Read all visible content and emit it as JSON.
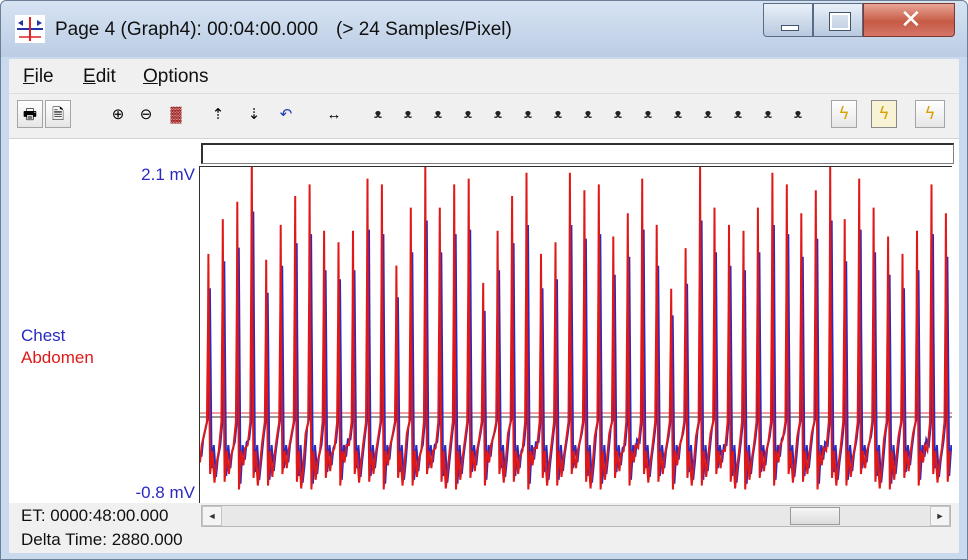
{
  "window": {
    "title": "Page 4 (Graph4): 00:04:00.000",
    "rate": "(> 24 Samples/Pixel)"
  },
  "menu": {
    "file": {
      "first": "F",
      "rest": "ile"
    },
    "edit": {
      "first": "E",
      "rest": "dit"
    },
    "options": {
      "first": "O",
      "rest": "ptions"
    }
  },
  "toolbar": {
    "icons": [
      "print-icon",
      "page-setup-icon",
      "zoom-in-icon",
      "zoom-out-icon",
      "fit-all-icon",
      "expand-vertical-icon",
      "compress-vertical-icon",
      "undo-icon",
      "horizontal-scale-icon",
      "find-marker-1-icon",
      "find-marker-2-icon",
      "find-marker-3-icon",
      "find-marker-4-icon",
      "find-event-1-icon",
      "find-event-2-icon",
      "find-event-3-icon",
      "find-event-4-icon",
      "find-event-5-icon",
      "find-event-6-icon",
      "find-event-7-icon",
      "find-event-8-icon",
      "find-event-9-icon",
      "event-bolt-1-icon",
      "event-bolt-2-icon",
      "event-bolt-3-icon"
    ]
  },
  "graph": {
    "scale_max": "2.1 mV",
    "scale_min": "-0.8 mV",
    "channels": [
      {
        "name": "Chest",
        "color": "#2a2ac0"
      },
      {
        "name": "Abdomen",
        "color": "#e01818"
      }
    ]
  },
  "chart_data": {
    "type": "line",
    "ylim": [
      -0.8,
      2.1
    ],
    "x_window": "00:04:00.000",
    "peaks_mV": [
      1.35,
      1.65,
      1.8,
      2.2,
      1.3,
      1.6,
      1.85,
      1.95,
      1.55,
      1.45,
      1.55,
      2.0,
      1.95,
      1.25,
      1.75,
      2.1,
      1.75,
      1.95,
      2.0,
      1.1,
      1.55,
      1.85,
      2.05,
      1.35,
      1.45,
      2.05,
      1.9,
      1.95,
      1.5,
      1.7,
      2.0,
      1.6,
      1.05,
      1.4,
      2.1,
      1.75,
      1.6,
      1.55,
      1.75,
      2.05,
      1.95,
      1.7,
      1.9,
      2.1,
      1.65,
      2.0,
      1.75,
      1.5,
      1.35,
      1.55,
      1.95,
      1.7
    ]
  },
  "status": {
    "et": "ET: 0000:48:00.000",
    "delta": "Delta Time: 2880.000"
  },
  "scrollbar": {
    "left_arrow": "◄",
    "right_arrow": "►"
  }
}
